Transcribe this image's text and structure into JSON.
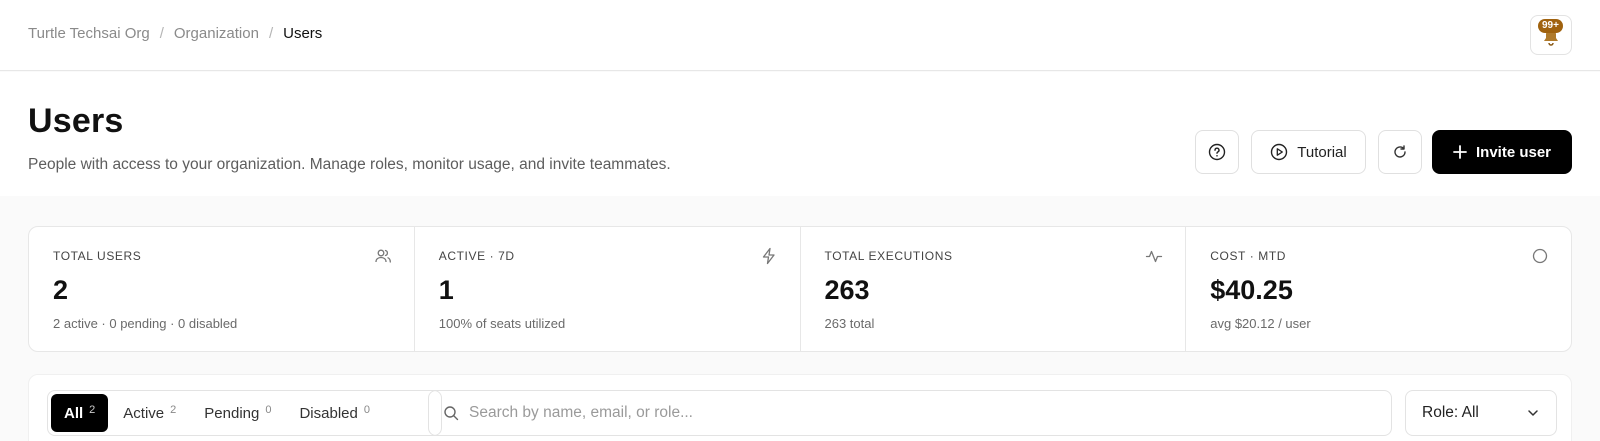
{
  "breadcrumb": {
    "items": [
      "Turtle Techsai Org",
      "Organization",
      "Users"
    ]
  },
  "notifications": {
    "badge": "99+"
  },
  "header": {
    "title": "Users",
    "subtitle": "People with access to your organization. Manage roles, monitor usage, and invite teammates."
  },
  "actions": {
    "tutorial_label": "Tutorial",
    "invite_label": "Invite user"
  },
  "stats": [
    {
      "label": "TOTAL USERS",
      "value": "2",
      "sub": "2 active · 0 pending · 0 disabled",
      "icon": "users-icon"
    },
    {
      "label": "ACTIVE · 7D",
      "value": "1",
      "sub": "100% of seats utilized",
      "icon": "bolt-icon"
    },
    {
      "label": "TOTAL EXECUTIONS",
      "value": "263",
      "sub": "263 total",
      "icon": "activity-icon"
    },
    {
      "label": "COST · MTD",
      "value": "$40.25",
      "sub": "avg $20.12 / user",
      "icon": "circle-icon"
    }
  ],
  "filters": {
    "tabs": [
      {
        "label": "All",
        "count": "2"
      },
      {
        "label": "Active",
        "count": "2"
      },
      {
        "label": "Pending",
        "count": "0"
      },
      {
        "label": "Disabled",
        "count": "0"
      }
    ],
    "search_placeholder": "Search by name, email, or role...",
    "role_select": "Role: All"
  },
  "colors": {
    "badge": "#a0620e",
    "primary_button": "#000000",
    "page_bg": "#fafafa"
  }
}
